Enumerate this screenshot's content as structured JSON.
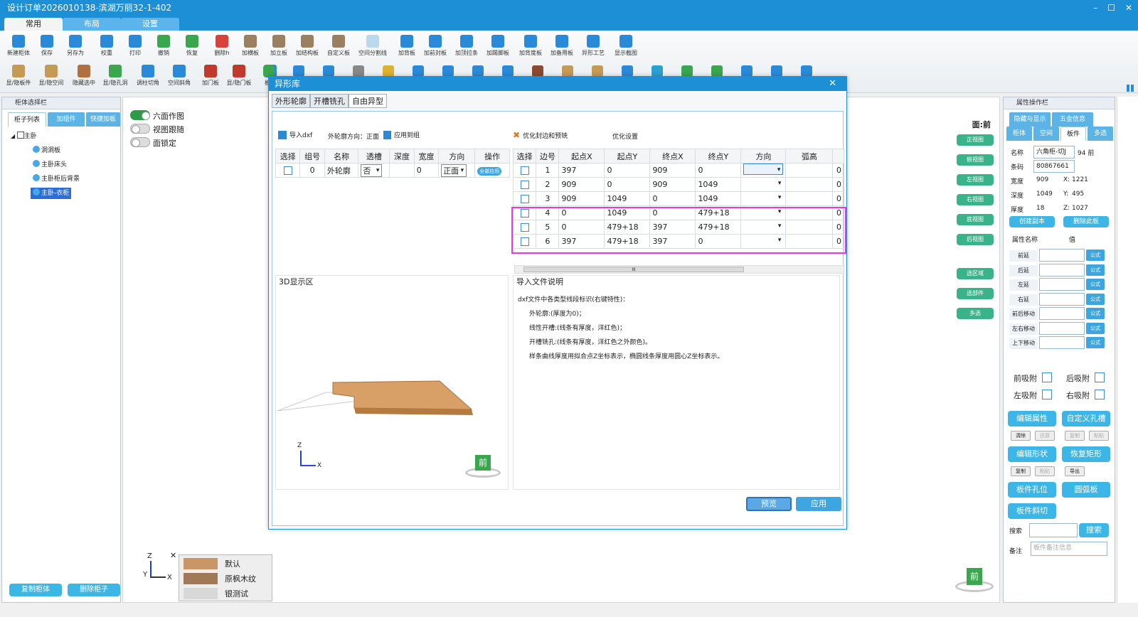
{
  "window": {
    "title": "设计订单2026010138-滨湖万丽32-1-402",
    "min": "–",
    "max": "☐",
    "close": "✕"
  },
  "main_tabs": [
    "常用",
    "布局",
    "设置"
  ],
  "toolbar1": [
    {
      "label": "新建柜体",
      "icon": "new-cabinet-icon",
      "color": "#2a8ad8"
    },
    {
      "label": "保存",
      "icon": "save-icon",
      "color": "#2a8ad8"
    },
    {
      "label": "另存为",
      "icon": "save-as-icon",
      "color": "#2a8ad8"
    },
    {
      "label": "校重",
      "icon": "check-icon",
      "color": "#2a8ad8"
    },
    {
      "label": "打印",
      "icon": "print-icon",
      "color": "#2a8ad8"
    },
    {
      "label": "撤销",
      "icon": "undo-icon",
      "color": "#3aa64e"
    },
    {
      "label": "恢复",
      "icon": "redo-icon",
      "color": "#3aa64e"
    },
    {
      "label": "删除h",
      "icon": "delete-icon",
      "color": "#d9413a"
    },
    {
      "label": "加横板",
      "icon": "add-horizontal-board-icon",
      "color": "#9a8060"
    },
    {
      "label": "加立板",
      "icon": "add-vertical-board-icon",
      "color": "#9a8060"
    },
    {
      "label": "加结构板",
      "icon": "add-structure-board-icon",
      "color": "#9a8060"
    },
    {
      "label": "自定义板",
      "icon": "custom-board-icon",
      "color": "#9a8060"
    },
    {
      "label": "空间分割线",
      "icon": "space-split-icon",
      "color": "#bcd8ec"
    },
    {
      "label": "加背板",
      "icon": "add-back-board-icon",
      "color": "#2a8ad8"
    },
    {
      "label": "加前封板",
      "icon": "add-front-seal-icon",
      "color": "#2a8ad8"
    },
    {
      "label": "加顶拉条",
      "icon": "add-top-strip-icon",
      "color": "#2a8ad8"
    },
    {
      "label": "加踢脚板",
      "icon": "add-kickboard-icon",
      "color": "#2a8ad8"
    },
    {
      "label": "加背度板",
      "icon": "add-back-degree-icon",
      "color": "#2a8ad8"
    },
    {
      "label": "加备用板",
      "icon": "add-spare-board-icon",
      "color": "#2a8ad8"
    },
    {
      "label": "异形工艺",
      "icon": "special-shape-icon",
      "color": "#2a8ad8"
    },
    {
      "label": "显示截图",
      "icon": "screenshot-icon",
      "color": "#2a8ad8"
    }
  ],
  "toolbar2": [
    {
      "label": "显/隐板件",
      "icon": "toggle-board-icon",
      "color": "#c59a55"
    },
    {
      "label": "显/隐空间",
      "icon": "toggle-space-icon",
      "color": "#c59a55"
    },
    {
      "label": "隐藏选中",
      "icon": "hide-selected-icon",
      "color": "#b07040"
    },
    {
      "label": "显/隐孔洞",
      "icon": "toggle-holes-icon",
      "color": "#3aa64e"
    },
    {
      "label": "调柱切角",
      "icon": "corner-cut-icon",
      "color": "#2a8ad8"
    },
    {
      "label": "空间斜角",
      "icon": "space-bevel-icon",
      "color": "#2a8ad8"
    },
    {
      "label": "加门板",
      "icon": "add-door-icon",
      "color": "#c0392b"
    },
    {
      "label": "显/隐门板",
      "icon": "toggle-door-icon",
      "color": "#c0392b"
    },
    {
      "label": "板子",
      "icon": "board-icon",
      "color": "#2a8ad8"
    }
  ],
  "toolbar2_extra": [
    "#3aa64e",
    "#2a8ad8",
    "#2a8ad8",
    "#888",
    "#e0b030",
    "#2a8ad8",
    "#2a8ad8",
    "#2a8ad8",
    "#2a8ad8",
    "#8b4a2b",
    "#c59a55",
    "#c59a55",
    "#2a8ad8",
    "#2aa0d0",
    "#3aa64e",
    "#3aa64e",
    "#2a8ad8",
    "#2a8ad8",
    "#2a8ad8"
  ],
  "left_panel": {
    "title": "柜体选择栏",
    "tabs": [
      "柜子列表",
      "加组件",
      "快捷加板"
    ],
    "tree": {
      "root": "主卧",
      "items": [
        "洞洞板",
        "主卧床头",
        "主卧柜后背景",
        "主卧-衣柜"
      ],
      "selected_index": 3
    },
    "copy_btn": "复制柜体",
    "delete_btn": "删除柜子"
  },
  "viewport": {
    "toggles": [
      {
        "label": "六面作图",
        "on": true
      },
      {
        "label": "视图跟随",
        "on": false
      },
      {
        "label": "面锁定",
        "on": false
      }
    ],
    "face_label": "面:前",
    "view_btns": [
      "正视图",
      "俯视图",
      "左视图",
      "右视图",
      "底视图",
      "后视图"
    ],
    "select_btns": [
      "选区域",
      "选部件",
      "多选"
    ],
    "axis_z": "Z",
    "axis_y": "Y",
    "axis_x": "X",
    "cube_label": "前",
    "close_mark": "✕"
  },
  "materials": [
    {
      "name": "默认",
      "color": "#c99767"
    },
    {
      "name": "原枫木纹",
      "color": "#a07a58"
    },
    {
      "name": "银测试",
      "color": "#d8d8d8"
    }
  ],
  "dialog": {
    "title": "异形库",
    "close": "✕",
    "tabs": [
      "外形轮廓",
      "开槽铣孔",
      "自由异型"
    ],
    "import_dxf": "导入dxf",
    "outline_dir_label": "外轮廓方向：正面",
    "apply_group": "应用到组",
    "optimize": "优化封边和预铣",
    "optimize_settings": "优化设置",
    "left_headers": [
      "选择",
      "组号",
      "名称",
      "透槽",
      "深度",
      "宽度",
      "方向",
      "操作"
    ],
    "left_row": {
      "group": "0",
      "name": "外轮廓",
      "through": "否",
      "depth": "",
      "width": "0",
      "direction": "正面",
      "action": "全部应用"
    },
    "right_headers": [
      "选择",
      "边号",
      "起点X",
      "起点Y",
      "终点X",
      "终点Y",
      "方向",
      "弧高",
      ""
    ],
    "right_rows": [
      {
        "edge": "1",
        "sx": "397",
        "sy": "0",
        "ex": "909",
        "ey": "0",
        "arc": "",
        "last": "0",
        "highlight": false
      },
      {
        "edge": "2",
        "sx": "909",
        "sy": "0",
        "ex": "909",
        "ey": "1049",
        "arc": "",
        "last": "0",
        "highlight": false
      },
      {
        "edge": "3",
        "sx": "909",
        "sy": "1049",
        "ex": "0",
        "ey": "1049",
        "arc": "",
        "last": "0",
        "highlight": false
      },
      {
        "edge": "4",
        "sx": "0",
        "sy": "1049",
        "ex": "0",
        "ey": "479+18",
        "arc": "",
        "last": "0",
        "highlight": true
      },
      {
        "edge": "5",
        "sx": "0",
        "sy": "479+18",
        "ex": "397",
        "ey": "479+18",
        "arc": "",
        "last": "0",
        "highlight": true
      },
      {
        "edge": "6",
        "sx": "397",
        "sy": "479+18",
        "ex": "397",
        "ey": "0",
        "arc": "",
        "last": "0",
        "highlight": true
      }
    ],
    "scroll_mark": "III",
    "display_3d_title": "3D显示区",
    "import_desc_title": "导入文件说明",
    "import_desc_lines": [
      "dxf文件中各类型线段标识(右键特性)：",
      "外轮廓:(厚度为0)；",
      "线性开槽:(线条有厚度，洋红色)；",
      "开槽铣孔:(线条有厚度，洋红色之外颜色)。",
      "样条曲线厚度用拟合点Z坐标表示，椭圆线条厚度用圆心Z坐标表示。"
    ],
    "cube_label": "前",
    "axis_z": "Z",
    "axis_x": "X",
    "preview_btn": "预览",
    "apply_btn": "应用"
  },
  "right_panel": {
    "title": "属性操作栏",
    "tabs_top": [
      "隐藏与显示",
      "五金信息"
    ],
    "tabs": [
      "柜体",
      "空间",
      "板件",
      "多选"
    ],
    "active_tab": 2,
    "name_label": "名称",
    "name_value": "六角柜-切J",
    "name_extra": "94 前",
    "barcode_label": "条码",
    "barcode_value": "80867661",
    "width_label": "宽度",
    "width_value": "909",
    "x_label": "X:",
    "x_value": "1221",
    "depth_label": "深度",
    "depth_value": "1049",
    "y_label": "Y:",
    "y_value": "495",
    "thick_label": "厚度",
    "thick_value": "18",
    "z_label": "Z:",
    "z_value": "1027",
    "create_copy": "创建副本",
    "delete_board": "删除此板",
    "attr_header": "属性名称",
    "value_header": "值",
    "attrs": [
      "前延",
      "后延",
      "左延",
      "右延",
      "前后移动",
      "左右移动",
      "上下移动"
    ],
    "formula": "公式",
    "snaps": [
      "前吸附",
      "后吸附",
      "左吸附",
      "右吸附"
    ],
    "edit_attr": "编辑属性",
    "custom_hole": "自定义孔槽",
    "small1": [
      "清除",
      "还原",
      "复制",
      "粘贴"
    ],
    "edit_shape": "编辑形状",
    "restore_rect": "恢复矩形",
    "small2": [
      "复制",
      "粘贴",
      "导出"
    ],
    "hole_pos": "板件孔位",
    "arc_board": "圆弧板",
    "bevel": "板件斜切",
    "search_label": "搜索",
    "search_btn": "搜索",
    "remark_label": "备注",
    "remark_placeholder": "板件备注信息"
  }
}
